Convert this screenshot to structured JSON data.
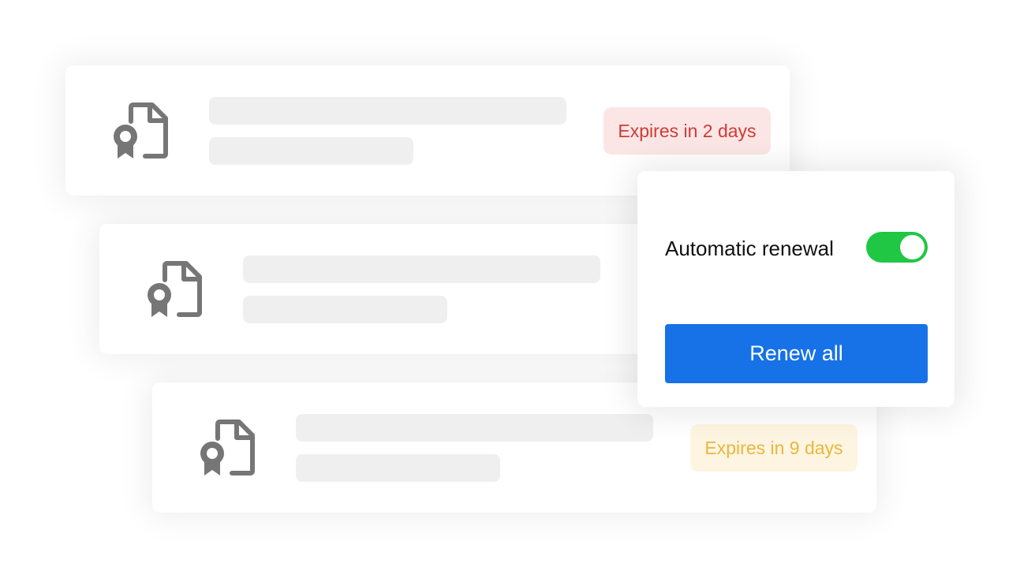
{
  "certificates": [
    {
      "icon": "certificate-file-icon",
      "badge": "Expires in 2 days",
      "badge_status": "urgent"
    },
    {
      "icon": "certificate-file-icon",
      "badge": "",
      "badge_status": "none"
    },
    {
      "icon": "certificate-file-icon",
      "badge": "Expires in 9 days",
      "badge_status": "warning"
    }
  ],
  "renewal_panel": {
    "toggle_label": "Automatic renewal",
    "toggle_on": true,
    "button_label": "Renew all"
  },
  "colors": {
    "urgent_text": "#cf3a36",
    "urgent_bg": "#fbe6e5",
    "warning_text": "#ebb63b",
    "warning_bg": "#fdf5e1",
    "toggle_on": "#20c745",
    "primary_button": "#1672e6",
    "icon_gray": "#767676",
    "skeleton": "#efefef"
  }
}
